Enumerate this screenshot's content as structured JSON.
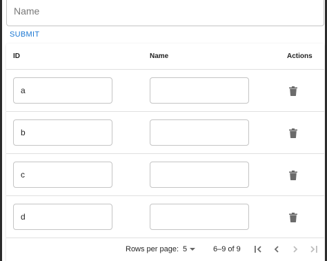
{
  "form": {
    "name_placeholder": "Name",
    "submit_label": "SUBMIT"
  },
  "table": {
    "headers": {
      "id": "ID",
      "name": "Name",
      "actions": "Actions"
    },
    "rows": [
      {
        "id": "a",
        "name": ""
      },
      {
        "id": "b",
        "name": ""
      },
      {
        "id": "c",
        "name": ""
      },
      {
        "id": "d",
        "name": ""
      }
    ],
    "action_icon": "trash-icon"
  },
  "pagination": {
    "rows_per_page_label": "Rows per page:",
    "rows_per_page_value": "5",
    "range_label": "6–9 of 9",
    "icons": [
      "first-page-icon",
      "previous-page-icon",
      "next-page-icon",
      "last-page-icon"
    ]
  },
  "colors": {
    "accent": "#1976d2",
    "border": "#c4c4c4",
    "divider": "#e0e0e0",
    "icon": "#6b6b6b",
    "icon_disabled": "#bdbdbd"
  }
}
